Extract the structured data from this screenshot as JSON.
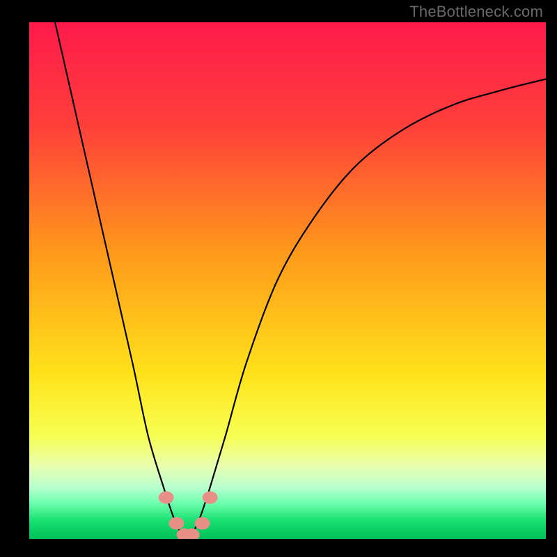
{
  "watermark": "TheBottleneck.com",
  "chart_data": {
    "type": "line",
    "title": "",
    "xlabel": "",
    "ylabel": "",
    "xlim": [
      0,
      100
    ],
    "ylim": [
      0,
      100
    ],
    "gradient_stops": [
      {
        "offset": 0,
        "color": "#ff1a4b"
      },
      {
        "offset": 0.2,
        "color": "#ff3f3a"
      },
      {
        "offset": 0.45,
        "color": "#ff9a1a"
      },
      {
        "offset": 0.68,
        "color": "#ffe21a"
      },
      {
        "offset": 0.8,
        "color": "#f7ff52"
      },
      {
        "offset": 0.86,
        "color": "#e8ffb0"
      },
      {
        "offset": 0.9,
        "color": "#b8ffd0"
      },
      {
        "offset": 0.93,
        "color": "#6fffb0"
      },
      {
        "offset": 0.965,
        "color": "#18e070"
      },
      {
        "offset": 1.0,
        "color": "#00c05a"
      }
    ],
    "series": [
      {
        "name": "bottleneck-curve",
        "x": [
          5,
          10,
          15,
          20,
          23,
          26,
          28,
          29.5,
          30.5,
          31.5,
          33,
          35,
          38,
          42,
          48,
          55,
          63,
          72,
          82,
          92,
          100
        ],
        "y": [
          100,
          78,
          56,
          34,
          20,
          10,
          4,
          1,
          0.5,
          1,
          4,
          10,
          20,
          34,
          50,
          62,
          72,
          79,
          84,
          87,
          89
        ]
      }
    ],
    "markers": {
      "name": "highlight-dots",
      "color": "#e88f87",
      "points": [
        {
          "x": 26.5,
          "y": 8
        },
        {
          "x": 28.5,
          "y": 3
        },
        {
          "x": 30,
          "y": 0.8
        },
        {
          "x": 31.5,
          "y": 0.8
        },
        {
          "x": 33.5,
          "y": 3
        },
        {
          "x": 35,
          "y": 8
        }
      ]
    }
  }
}
